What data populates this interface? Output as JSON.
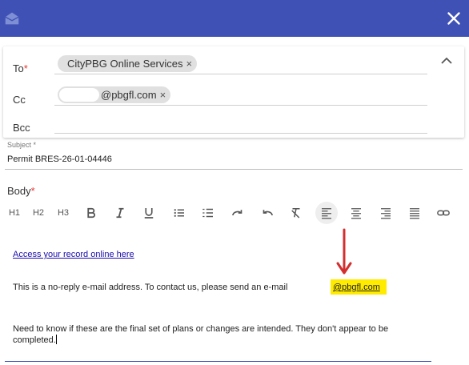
{
  "icons": {
    "mail": "mail-open-icon",
    "close": "close-icon",
    "collapse": "chevron-up-icon",
    "annotation": "red-arrow-down"
  },
  "colors": {
    "header": "#3f51b5",
    "required": "#e53935",
    "highlight": "#ffeb00",
    "link": "#1a0dab",
    "arrow": "#d32f2f"
  },
  "recipients": {
    "to_label": "To",
    "required_mark": "*",
    "to_chip": "CityPBG Online Services",
    "cc_label": "Cc",
    "cc_chip": "@pbgfl.com",
    "bcc_label": "Bcc",
    "chip_remove": "×"
  },
  "subject": {
    "label": "Subject *",
    "value": "Permit BRES-26-01-04446"
  },
  "body": {
    "label": "Body",
    "required_mark": "*",
    "toolbar": {
      "h1": "H1",
      "h2": "H2",
      "h3": "H3"
    },
    "link_text": "Access your record online here",
    "noreply_text": "This is a no-reply e-mail address. To contact us, please send an e-mail",
    "email_link": "@pbgfl.com",
    "message": "Need to know if these are the final set of plans or changes are intended.  They don't appear to be completed."
  }
}
